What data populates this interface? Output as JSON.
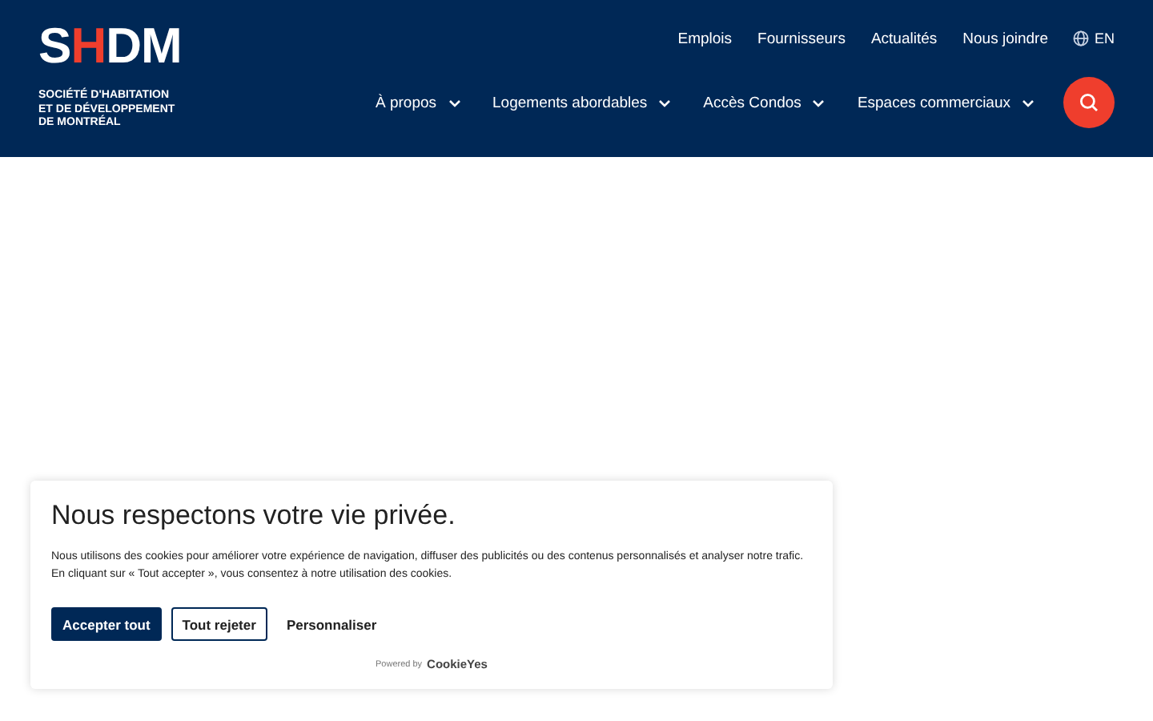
{
  "logo": {
    "mark": "SHDM",
    "name": "SOCIÉTÉ D'HABITATION\nET DE DÉVELOPPEMENT\nDE MONTRÉAL"
  },
  "top_links": [
    "Emplois",
    "Fournisseurs",
    "Actualités",
    "Nous joindre"
  ],
  "language": "EN",
  "nav": [
    "À propos",
    "Logements abordables",
    "Accès Condos",
    "Espaces commerciaux"
  ],
  "cookie_banner": {
    "title": "Nous respectons votre vie privée.",
    "text": "Nous utilisons des cookies pour améliorer votre expérience de navigation, diffuser des publicités ou des contenus personnalisés et analyser notre trafic. En cliquant sur « Tout accepter », vous consentez à notre utilisation des cookies.",
    "buttons": [
      {
        "label": "Accepter tout",
        "kind": "primary"
      },
      {
        "label": "Tout rejeter",
        "kind": "outline"
      },
      {
        "label": "Personnaliser",
        "kind": "text"
      }
    ],
    "powered_by": "Powered by",
    "brand": "CookieYes"
  }
}
